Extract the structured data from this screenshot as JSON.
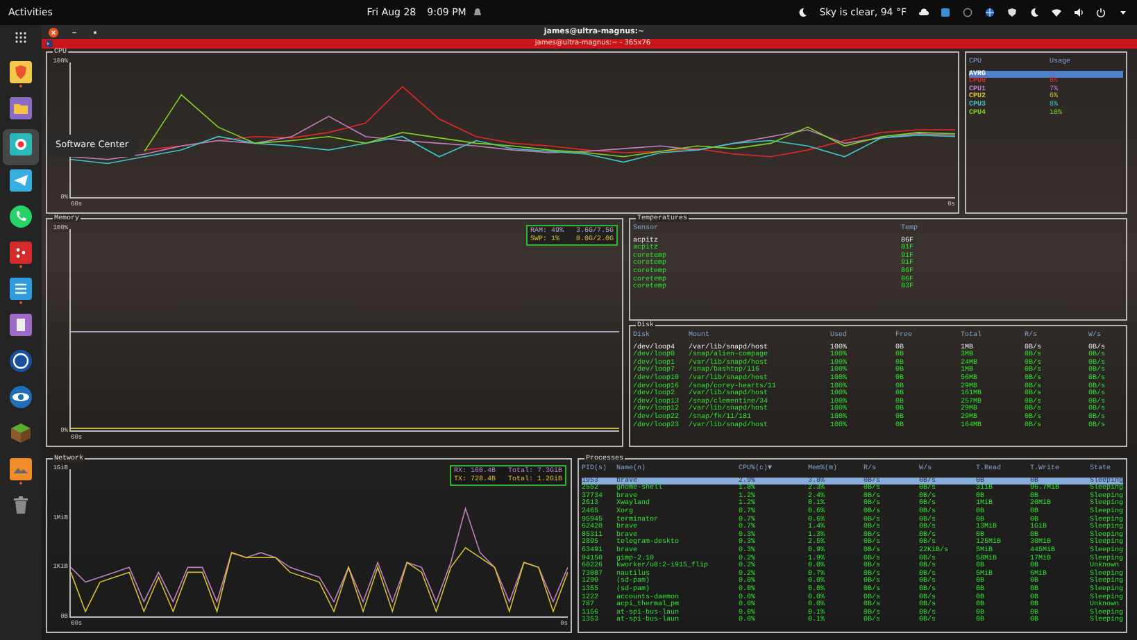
{
  "top_bar": {
    "activities": "Activities",
    "date": "Fri Aug 28",
    "time": "9:09 PM",
    "weather": "Sky is clear, 94 °F"
  },
  "dock": {
    "tooltip": "Software Center",
    "items": [
      {
        "kind": "shield",
        "running": true,
        "hovered": false
      },
      {
        "kind": "folder",
        "running": false,
        "hovered": false
      },
      {
        "kind": "record",
        "running": false,
        "hovered": true
      },
      {
        "kind": "plane",
        "running": false,
        "hovered": false
      },
      {
        "kind": "phone",
        "running": false,
        "hovered": false
      },
      {
        "kind": "dots",
        "running": true,
        "hovered": false
      },
      {
        "kind": "notes",
        "running": true,
        "hovered": false
      },
      {
        "kind": "document",
        "running": false,
        "hovered": false
      },
      {
        "kind": "disc",
        "running": false,
        "hovered": false
      },
      {
        "kind": "globe",
        "running": false,
        "hovered": false
      },
      {
        "kind": "block",
        "running": false,
        "hovered": false
      },
      {
        "kind": "image",
        "running": true,
        "hovered": false
      },
      {
        "kind": "trash",
        "running": false,
        "hovered": false
      }
    ]
  },
  "terminal": {
    "title": "james@ultra-magnus:~",
    "tab_title": "james@ultra-magnus:~ - 365x76",
    "cpu": {
      "title": "CPU",
      "time_labels": [
        "60s",
        "0s"
      ],
      "chart_data": {
        "type": "line",
        "ylim": [
          0,
          100
        ],
        "yticks": [
          {
            "value": 0,
            "label": "0%"
          },
          {
            "value": 100,
            "label": "100%"
          }
        ],
        "series": [
          {
            "color": "#e02828",
            "values": [
              null,
              null,
              35,
              38,
              42,
              45,
              44,
              48,
              55,
              82,
              58,
              45,
              40,
              38,
              35,
              33,
              34,
              36,
              32,
              30,
              35,
              42,
              48,
              50,
              50
            ]
          },
          {
            "color": "#c080c0",
            "values": [
              30,
              28,
              32,
              38,
              42,
              40,
              45,
              60,
              45,
              42,
              40,
              38,
              35,
              33,
              34,
              36,
              38,
              35,
              40,
              45,
              50,
              40,
              44,
              47,
              46
            ]
          },
          {
            "color": "#3cc8c8",
            "values": [
              28,
              25,
              30,
              35,
              45,
              40,
              38,
              35,
              40,
              45,
              30,
              42,
              36,
              34,
              32,
              26,
              33,
              35,
              40,
              42,
              38,
              30,
              44,
              46,
              45
            ]
          },
          {
            "color": "#7ed321",
            "values": [
              null,
              null,
              34,
              76,
              52,
              40,
              42,
              45,
              40,
              48,
              44,
              40,
              38,
              35,
              33,
              30,
              34,
              38,
              36,
              40,
              52,
              38,
              45,
              48,
              47
            ]
          }
        ]
      }
    },
    "cpu_legend": {
      "columns": [
        "CPU",
        "Usage"
      ],
      "rows": [
        {
          "label": "AVRG",
          "selected": true
        },
        {
          "label": "CPU0",
          "usage": "8%",
          "color": "#e02828",
          "selected": false
        },
        {
          "label": "CPU1",
          "usage": "7%",
          "color": "#c080c0",
          "selected": false
        },
        {
          "label": "CPU2",
          "usage": "6%",
          "color": "#d8c030",
          "selected": false
        },
        {
          "label": "CPU3",
          "usage": "8%",
          "color": "#3cc8c8",
          "selected": false
        },
        {
          "label": "CPU4",
          "usage": "10%",
          "color": "#7ed321",
          "selected": false
        }
      ]
    },
    "memory": {
      "title": "Memory",
      "legend": [
        "RAM: 49%   3.6G/7.5G",
        "SWP: 1%    0.0G/2.0G"
      ],
      "time_labels": [
        "60s"
      ],
      "chart_data": {
        "type": "line",
        "ylim": [
          0,
          100
        ],
        "yticks": [
          {
            "value": 0,
            "label": "0%"
          },
          {
            "value": 100,
            "label": "100%"
          }
        ],
        "series": [
          {
            "color": "#b0a8c8",
            "values": [
              49,
              49,
              49,
              49,
              49,
              49,
              49,
              49,
              49,
              49,
              49,
              49,
              49,
              49,
              49,
              49,
              49,
              49,
              49,
              49,
              49,
              49,
              49,
              49,
              49
            ]
          },
          {
            "color": "#d8c030",
            "values": [
              1,
              1,
              1,
              1,
              1,
              1,
              1,
              1,
              1,
              1,
              1,
              1,
              1,
              1,
              1,
              1,
              1,
              1,
              1,
              1,
              1,
              1,
              1,
              1,
              1
            ]
          }
        ]
      }
    },
    "temperatures": {
      "title": "Temperatures",
      "columns": [
        "Sensor",
        "Temp"
      ],
      "rows": [
        {
          "cells": [
            "acpitz",
            "86F"
          ],
          "selected": true
        },
        {
          "cells": [
            "acpitz",
            "81F"
          ],
          "selected": false
        },
        {
          "cells": [
            "coretemp",
            "91F"
          ],
          "selected": false
        },
        {
          "cells": [
            "coretemp",
            "91F"
          ],
          "selected": false
        },
        {
          "cells": [
            "coretemp",
            "86F"
          ],
          "selected": false
        },
        {
          "cells": [
            "coretemp",
            "86F"
          ],
          "selected": false
        },
        {
          "cells": [
            "coretemp",
            "83F"
          ],
          "selected": false
        }
      ]
    },
    "disk": {
      "title": "Disk",
      "columns": [
        "Disk",
        "Mount",
        "Used",
        "Free",
        "Total",
        "R/s",
        "W/s"
      ],
      "rows": [
        {
          "cells": [
            "/dev/loop4",
            "/var/lib/snapd/host",
            "100%",
            "0B",
            "1MB",
            "0B/s",
            "0B/s"
          ],
          "selected": true
        },
        {
          "cells": [
            "/dev/loop0",
            "/snap/alien-compage",
            "100%",
            "0B",
            "3MB",
            "0B/s",
            "0B/s"
          ],
          "selected": false
        },
        {
          "cells": [
            "/dev/loop1",
            "/var/lib/snapd/host",
            "100%",
            "0B",
            "24MB",
            "0B/s",
            "0B/s"
          ],
          "selected": false
        },
        {
          "cells": [
            "/dev/loop7",
            "/snap/bashtop/116",
            "100%",
            "0B",
            "1MB",
            "0B/s",
            "0B/s"
          ],
          "selected": false
        },
        {
          "cells": [
            "/dev/loop10",
            "/var/lib/snapd/host",
            "100%",
            "0B",
            "56MB",
            "0B/s",
            "0B/s"
          ],
          "selected": false
        },
        {
          "cells": [
            "/dev/loop16",
            "/snap/corey-hearts/11",
            "100%",
            "0B",
            "29MB",
            "0B/s",
            "0B/s"
          ],
          "selected": false
        },
        {
          "cells": [
            "/dev/loop2",
            "/var/lib/snapd/host",
            "100%",
            "0B",
            "161MB",
            "0B/s",
            "0B/s"
          ],
          "selected": false
        },
        {
          "cells": [
            "/dev/loop13",
            "/snap/clementine/34",
            "100%",
            "0B",
            "257MB",
            "0B/s",
            "0B/s"
          ],
          "selected": false
        },
        {
          "cells": [
            "/dev/loop12",
            "/var/lib/snapd/host",
            "100%",
            "0B",
            "29MB",
            "0B/s",
            "0B/s"
          ],
          "selected": false
        },
        {
          "cells": [
            "/dev/loop22",
            "/snap/fk/11/181",
            "100%",
            "0B",
            "29MB",
            "0B/s",
            "0B/s"
          ],
          "selected": false
        },
        {
          "cells": [
            "/dev/loop23",
            "/var/lib/snapd/host",
            "100%",
            "0B",
            "164MB",
            "0B/s",
            "0B/s"
          ],
          "selected": false
        }
      ]
    },
    "network": {
      "title": "Network",
      "legend": [
        "RX: 160.4B   Total: 7.3GiB",
        "TX: 728.4B   Total: 1.2GiB"
      ],
      "axis_labels": [
        "1GiB",
        "1MiB",
        "1KiB",
        "0B"
      ],
      "time_labels": [
        "60s",
        "0s"
      ]
    },
    "processes": {
      "title": "Processes",
      "columns": [
        "PID(s)",
        "Name(n)",
        "CPU%(c)▼",
        "Mem%(m)",
        "R/s",
        "W/s",
        "T.Read",
        "T.Write",
        "State"
      ],
      "rows": [
        {
          "cells": [
            "1953",
            "brave",
            "2.9%",
            "3.8%",
            "0B/s",
            "0B/s",
            "0B",
            "0B",
            "Sleeping"
          ],
          "selected": true
        },
        {
          "cells": [
            "2552",
            "gnome-shell",
            "1.8%",
            "2.3%",
            "0B/s",
            "0B/s",
            "311B",
            "96.7MiB",
            "Sleeping"
          ],
          "selected": false
        },
        {
          "cells": [
            "37734",
            "brave",
            "1.2%",
            "2.4%",
            "0B/s",
            "0B/s",
            "0B",
            "0B",
            "Sleeping"
          ],
          "selected": false
        },
        {
          "cells": [
            "2613",
            "Xwayland",
            "1.2%",
            "0.1%",
            "0B/s",
            "0B/s",
            "1MiB",
            "20MiB",
            "Sleeping"
          ],
          "selected": false
        },
        {
          "cells": [
            "2465",
            "Xorg",
            "0.7%",
            "0.6%",
            "0B/s",
            "0B/s",
            "0B",
            "0B",
            "Sleeping"
          ],
          "selected": false
        },
        {
          "cells": [
            "95945",
            "terminator",
            "0.7%",
            "0.6%",
            "0B/s",
            "0B/s",
            "0B",
            "0B",
            "Sleeping"
          ],
          "selected": false
        },
        {
          "cells": [
            "62420",
            "brave",
            "0.7%",
            "1.4%",
            "0B/s",
            "0B/s",
            "13MiB",
            "1GiB",
            "Sleeping"
          ],
          "selected": false
        },
        {
          "cells": [
            "85311",
            "brave",
            "0.3%",
            "1.3%",
            "0B/s",
            "0B/s",
            "0B",
            "0B",
            "Sleeping"
          ],
          "selected": false
        },
        {
          "cells": [
            "2895",
            "telegram-deskto",
            "0.3%",
            "2.5%",
            "0B/s",
            "0B/s",
            "125MiB",
            "30MiB",
            "Sleeping"
          ],
          "selected": false
        },
        {
          "cells": [
            "63491",
            "brave",
            "0.3%",
            "0.9%",
            "0B/s",
            "22KiB/s",
            "5MiB",
            "445MiB",
            "Sleeping"
          ],
          "selected": false
        },
        {
          "cells": [
            "94150",
            "gimp-2.10",
            "0.2%",
            "1.9%",
            "0B/s",
            "0B/s",
            "58MiB",
            "17MiB",
            "Sleeping"
          ],
          "selected": false
        },
        {
          "cells": [
            "60226",
            "kworker/u8:2-i915_flip",
            "0.2%",
            "0.0%",
            "0B/s",
            "0B/s",
            "0B",
            "0B",
            "Unknown"
          ],
          "selected": false
        },
        {
          "cells": [
            "73087",
            "nautilus",
            "0.2%",
            "0.7%",
            "0B/s",
            "0B/s",
            "5MiB",
            "6MiB",
            "Sleeping"
          ],
          "selected": false
        },
        {
          "cells": [
            "1290",
            "(sd-pam)",
            "0.0%",
            "0.0%",
            "0B/s",
            "0B/s",
            "0B",
            "0B",
            "Sleeping"
          ],
          "selected": false
        },
        {
          "cells": [
            "1355",
            "(sd-pam)",
            "0.0%",
            "0.0%",
            "0B/s",
            "0B/s",
            "0B",
            "0B",
            "Sleeping"
          ],
          "selected": false
        },
        {
          "cells": [
            "1222",
            "accounts-daemon",
            "0.0%",
            "0.0%",
            "0B/s",
            "0B/s",
            "0B",
            "0B",
            "Sleeping"
          ],
          "selected": false
        },
        {
          "cells": [
            "787",
            "acpi_thermal_pm",
            "0.0%",
            "0.0%",
            "0B/s",
            "0B/s",
            "0B",
            "0B",
            "Unknown"
          ],
          "selected": false
        },
        {
          "cells": [
            "1156",
            "at-spi-bus-laun",
            "0.0%",
            "0.1%",
            "0B/s",
            "0B/s",
            "0B",
            "0B",
            "Sleeping"
          ],
          "selected": false
        },
        {
          "cells": [
            "1353",
            "at-spi-bus-laun",
            "0.0%",
            "0.1%",
            "0B/s",
            "0B/s",
            "0B",
            "0B",
            "Sleeping"
          ],
          "selected": false
        }
      ]
    }
  }
}
